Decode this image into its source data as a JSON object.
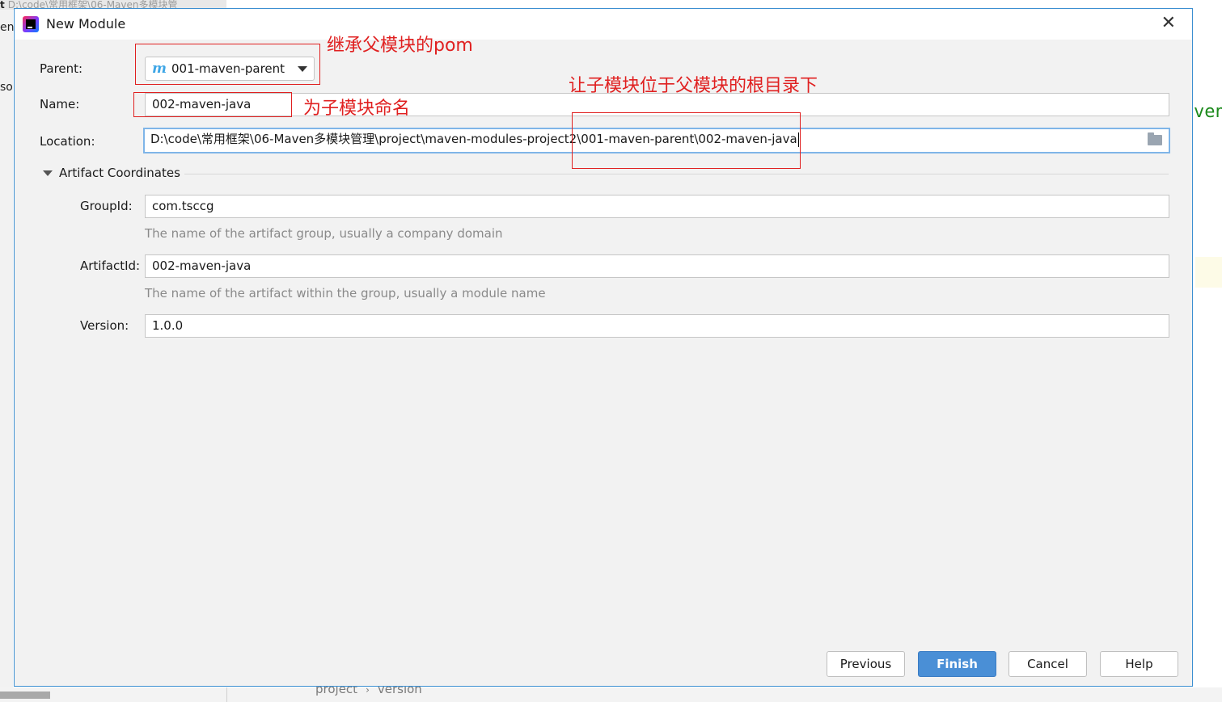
{
  "background": {
    "tab_prefix": "t",
    "tab_path": "D:\\code\\常用框架\\06-Maven多模块管",
    "left_fragments": [
      "en",
      "sol"
    ],
    "right_code": "ven",
    "breadcrumbs": [
      "project",
      "version"
    ]
  },
  "dialog": {
    "title": "New Module",
    "close_glyph": "✕",
    "parent_label": "Parent:",
    "parent_value": "001-maven-parent",
    "parent_icon": "m",
    "name_label": "Name:",
    "name_value": "002-maven-java",
    "location_label": "Location:",
    "location_value": "D:\\code\\常用框架\\06-Maven多模块管理\\project\\maven-modules-project2\\001-maven-parent\\002-maven-java",
    "section_title": "Artifact Coordinates",
    "groupid_label": "GroupId:",
    "groupid_value": "com.tsccg",
    "groupid_hint": "The name of the artifact group, usually a company domain",
    "artifactid_label": "ArtifactId:",
    "artifactid_value": "002-maven-java",
    "artifactid_hint": "The name of the artifact within the group, usually a module name",
    "version_label": "Version:",
    "version_value": "1.0.0",
    "buttons": {
      "previous": "Previous",
      "finish": "Finish",
      "cancel": "Cancel",
      "help": "Help"
    }
  },
  "annotations": {
    "parent_note": "继承父模块的pom",
    "location_note": "让子模块位于父模块的根目录下",
    "name_note": "为子模块命名",
    "color": "#e02020"
  },
  "icons": {
    "app": "intellij-idea-icon",
    "maven": "maven-m-icon",
    "dropdown": "chevron-down-icon",
    "browse": "folder-icon",
    "collapse": "triangle-down-icon"
  }
}
